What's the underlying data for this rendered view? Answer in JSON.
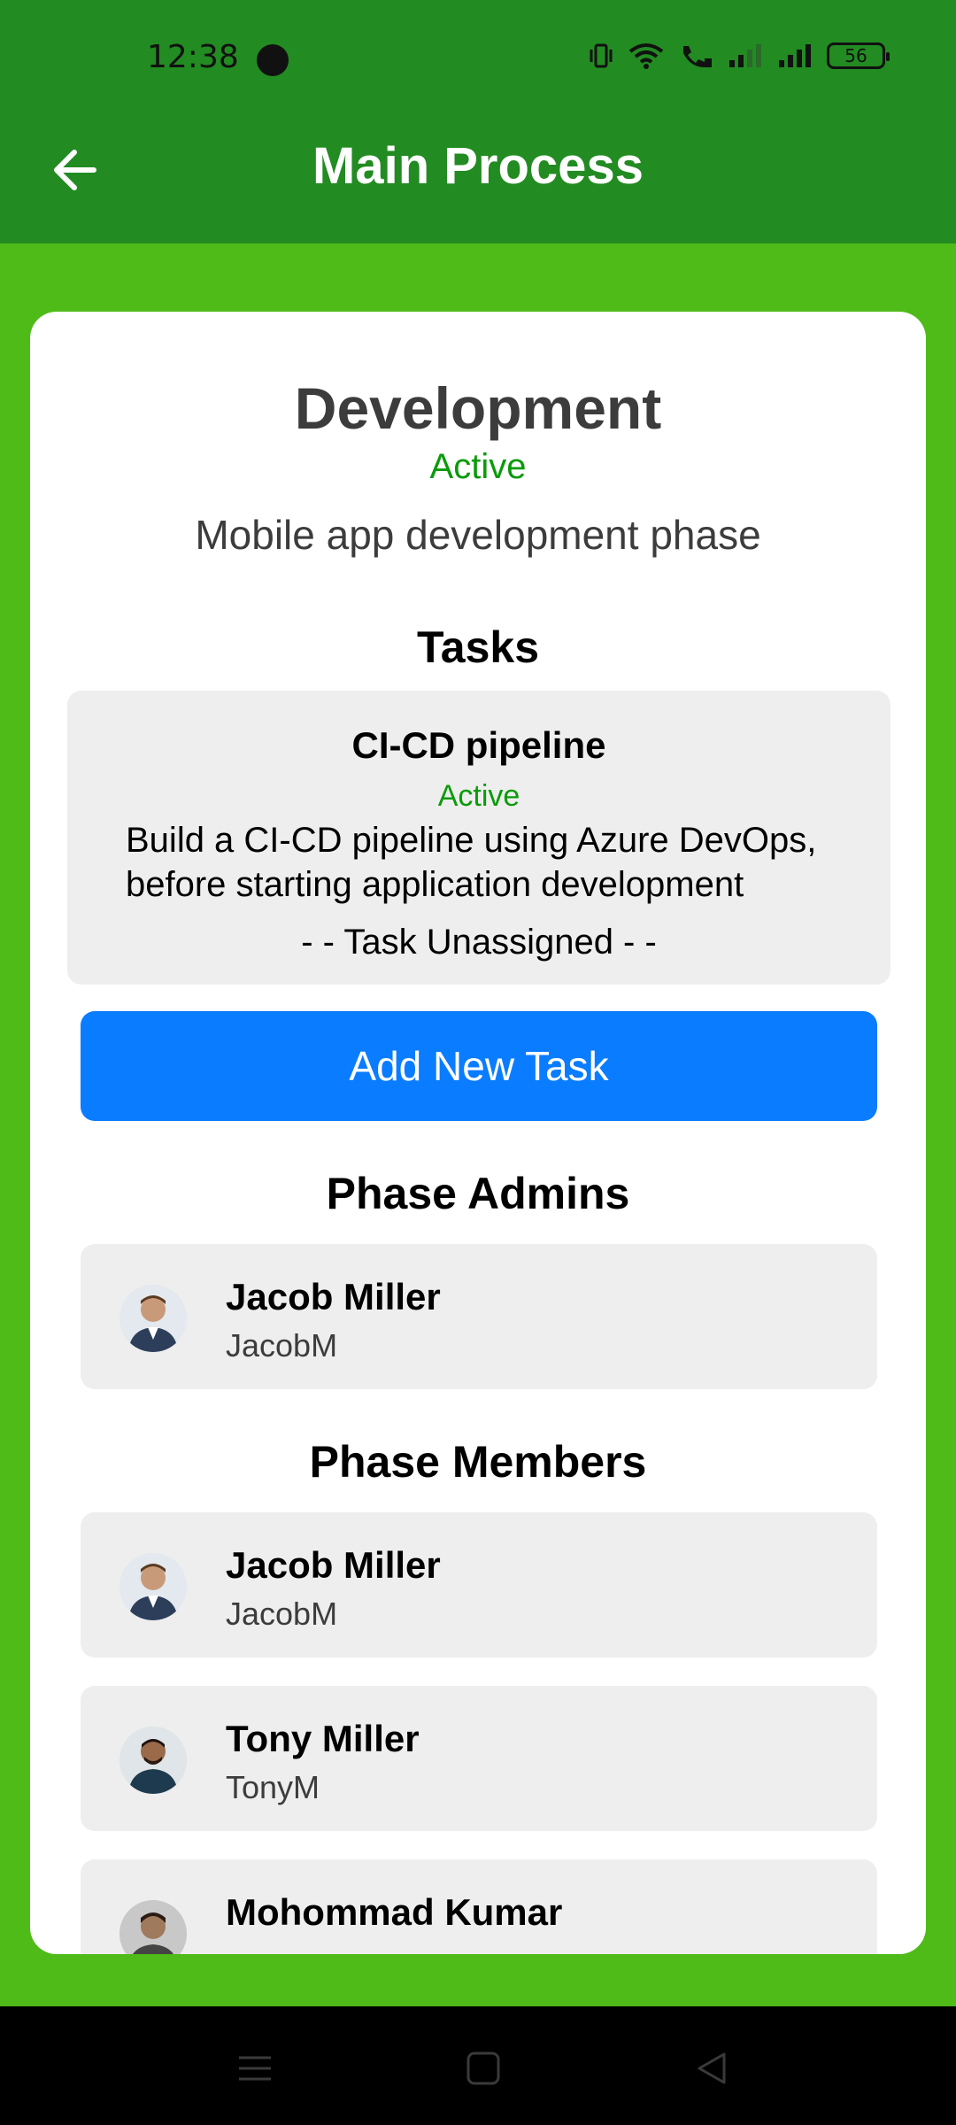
{
  "status_bar": {
    "time": "12:38",
    "battery": "56"
  },
  "app_bar": {
    "title": "Main Process"
  },
  "phase": {
    "title": "Development",
    "status": "Active",
    "description": "Mobile app development phase"
  },
  "tasks_section": {
    "heading": "Tasks",
    "items": [
      {
        "title": "CI-CD pipeline",
        "status": "Active",
        "description": "Build a CI-CD pipeline using Azure DevOps, before starting application development",
        "assignee": "- - Task Unassigned - -"
      }
    ],
    "add_button_label": "Add New Task"
  },
  "admins_section": {
    "heading": "Phase Admins",
    "items": [
      {
        "name": "Jacob Miller",
        "username": "JacobM"
      }
    ]
  },
  "members_section": {
    "heading": "Phase Members",
    "items": [
      {
        "name": "Jacob Miller",
        "username": "JacobM"
      },
      {
        "name": "Tony Miller",
        "username": "TonyM"
      },
      {
        "name": "Mohommad Kumar",
        "username": ""
      }
    ]
  },
  "colors": {
    "app_bar": "#228b22",
    "background": "#4fbb18",
    "active_status": "#0a9b0a",
    "primary_button": "#0a7cff"
  },
  "icons": [
    "back-arrow-icon",
    "menu-icon",
    "home-icon",
    "back-triangle-icon"
  ]
}
